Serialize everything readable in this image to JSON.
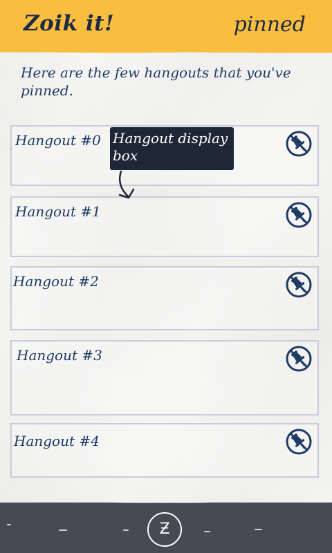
{
  "header": {
    "app_title": "Zoik it!",
    "page_tag": "pinned",
    "accent_color": "#f9be3f"
  },
  "intro_text": "Here are the few hangouts that you've pinned.",
  "hangouts": [
    {
      "label": "Hangout #0",
      "action_icon": "unpin-icon"
    },
    {
      "label": "Hangout #1",
      "action_icon": "unpin-icon"
    },
    {
      "label": "Hangout #2",
      "action_icon": "unpin-icon"
    },
    {
      "label": "Hangout #3",
      "action_icon": "unpin-icon"
    },
    {
      "label": "Hangout #4",
      "action_icon": "unpin-icon"
    }
  ],
  "tooltip": {
    "text": "Hangout display box",
    "color": "#1f2737"
  },
  "footer": {
    "home_button_glyph": "Ƶ",
    "home_icon": "zoik-logo-icon",
    "background_color": "#454a53"
  }
}
